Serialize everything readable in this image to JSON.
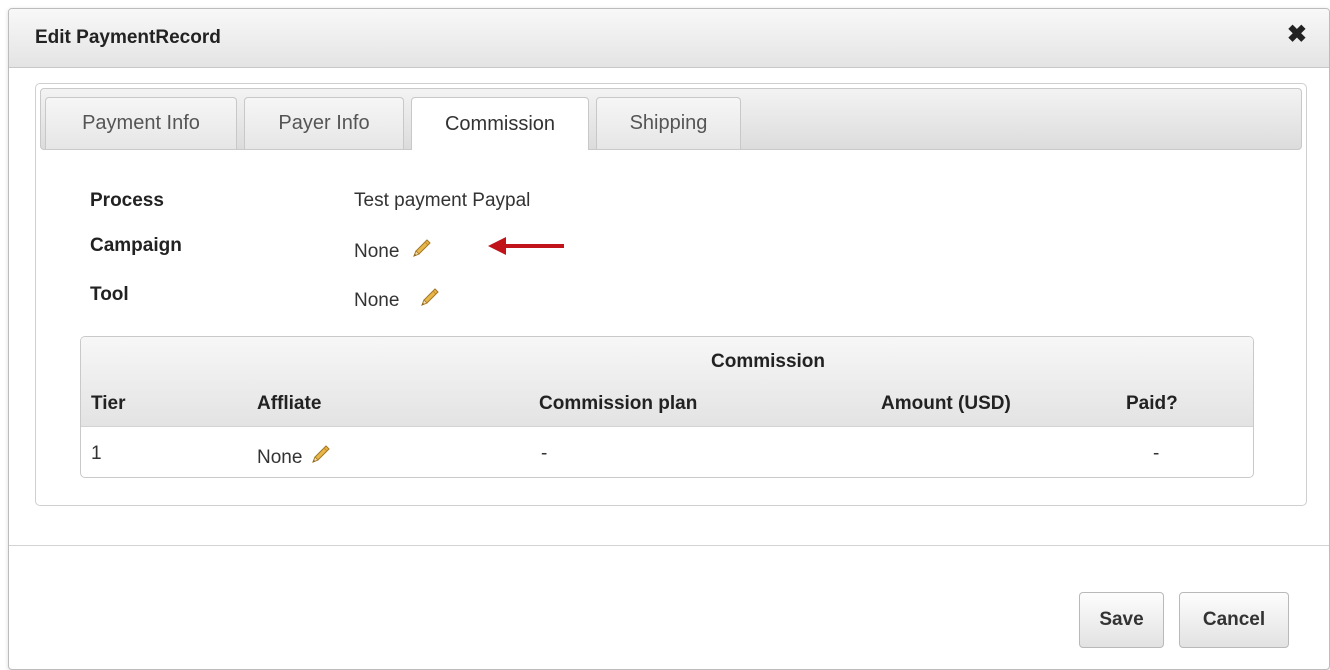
{
  "dialog": {
    "title": "Edit PaymentRecord",
    "close_symbol": "✖"
  },
  "tabs": [
    {
      "label": "Payment Info",
      "active": false
    },
    {
      "label": "Payer Info",
      "active": false
    },
    {
      "label": "Commission",
      "active": true
    },
    {
      "label": "Shipping",
      "active": false
    }
  ],
  "fields": {
    "process": {
      "label": "Process",
      "value": "Test payment Paypal"
    },
    "campaign": {
      "label": "Campaign",
      "value": "None",
      "edit_icon": "pencil-icon"
    },
    "tool": {
      "label": "Tool",
      "value": "None",
      "edit_icon": "pencil-icon"
    }
  },
  "annotation": {
    "icon": "red-arrow-icon",
    "color": "#c0141a"
  },
  "commission_table": {
    "title": "Commission",
    "columns": [
      "Tier",
      "Affliate",
      "Commission plan",
      "Amount (USD)",
      "Paid?"
    ],
    "rows": [
      {
        "tier": "1",
        "affiliate": "None",
        "plan": "-",
        "amount": "",
        "paid": "-"
      }
    ]
  },
  "buttons": {
    "save": "Save",
    "cancel": "Cancel"
  },
  "colors": {
    "pencil_body": "#e8b74a",
    "pencil_tip": "#7a5a1e"
  }
}
